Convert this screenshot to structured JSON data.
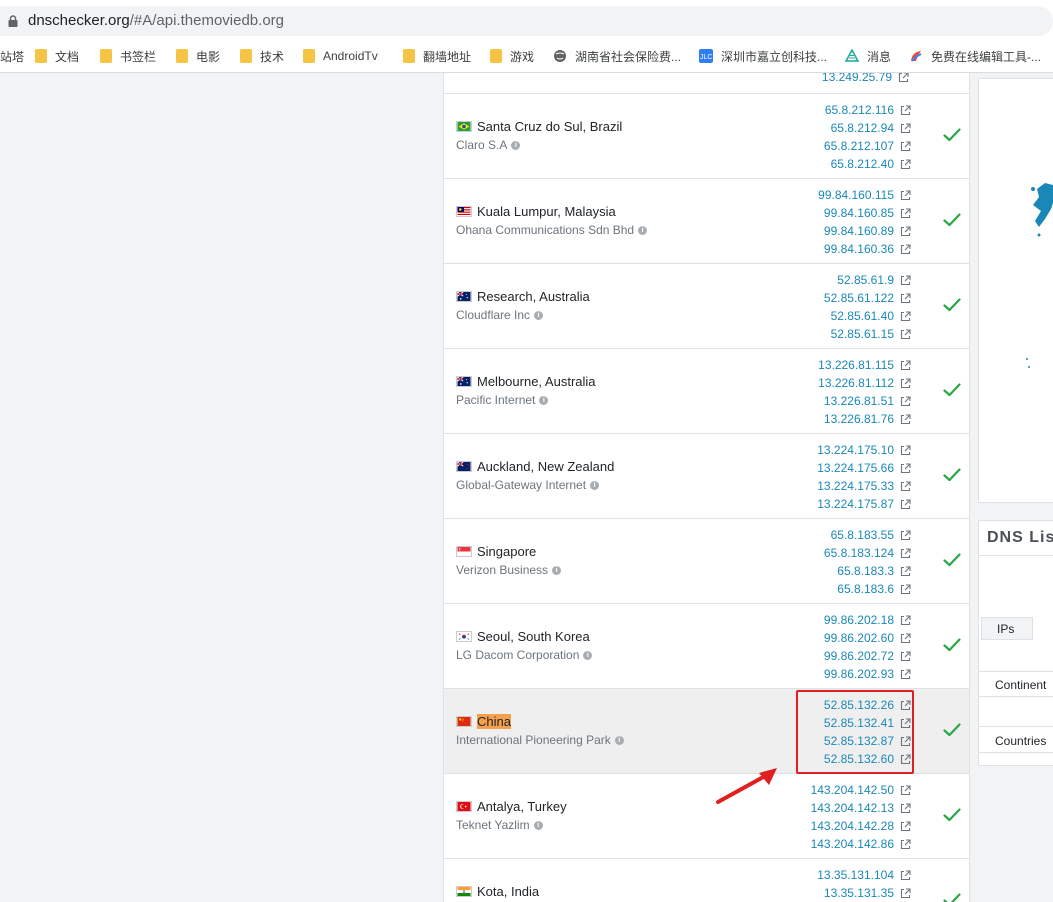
{
  "browser": {
    "url_domain": "dnschecker.org",
    "url_path": "/#A/api.themoviedb.org",
    "bookmarks": [
      {
        "label": "站塔",
        "type": "text"
      },
      {
        "label": "文档",
        "type": "folder"
      },
      {
        "label": "书签栏",
        "type": "folder"
      },
      {
        "label": "电影",
        "type": "folder"
      },
      {
        "label": "技术",
        "type": "folder"
      },
      {
        "label": "AndroidTv",
        "type": "folder"
      },
      {
        "label": "翻墙地址",
        "type": "folder"
      },
      {
        "label": "游戏",
        "type": "folder"
      },
      {
        "label": "湖南省社会保险费...",
        "type": "globe"
      },
      {
        "label": "深圳市嘉立创科技...",
        "type": "jlc"
      },
      {
        "label": "消息",
        "type": "msg"
      },
      {
        "label": "免费在线编辑工具-...",
        "type": "edit"
      }
    ]
  },
  "results": {
    "partial_top_ip": "13.249.25.79",
    "rows": [
      {
        "location": "Santa Cruz do Sul, Brazil",
        "provider": "Claro S.A",
        "flag": "br",
        "ips": [
          "65.8.212.116",
          "65.8.212.94",
          "65.8.212.107",
          "65.8.212.40"
        ]
      },
      {
        "location": "Kuala Lumpur, Malaysia",
        "provider": "Ohana Communications Sdn Bhd",
        "flag": "my",
        "ips": [
          "99.84.160.115",
          "99.84.160.85",
          "99.84.160.89",
          "99.84.160.36"
        ]
      },
      {
        "location": "Research, Australia",
        "provider": "Cloudflare Inc",
        "flag": "au",
        "ips": [
          "52.85.61.9",
          "52.85.61.122",
          "52.85.61.40",
          "52.85.61.15"
        ]
      },
      {
        "location": "Melbourne, Australia",
        "provider": "Pacific Internet",
        "flag": "au",
        "ips": [
          "13.226.81.115",
          "13.226.81.112",
          "13.226.81.51",
          "13.226.81.76"
        ]
      },
      {
        "location": "Auckland, New Zealand",
        "provider": "Global-Gateway Internet",
        "flag": "nz",
        "ips": [
          "13.224.175.10",
          "13.224.175.66",
          "13.224.175.33",
          "13.224.175.87"
        ]
      },
      {
        "location": "Singapore",
        "provider": "Verizon Business",
        "flag": "sg",
        "ips": [
          "65.8.183.55",
          "65.8.183.124",
          "65.8.183.3",
          "65.8.183.6"
        ]
      },
      {
        "location": "Seoul, South Korea",
        "provider": "LG Dacom Corporation",
        "flag": "kr",
        "ips": [
          "99.86.202.18",
          "99.86.202.60",
          "99.86.202.72",
          "99.86.202.93"
        ]
      },
      {
        "location": "China",
        "provider": "International Pioneering Park",
        "flag": "cn",
        "ips": [
          "52.85.132.26",
          "52.85.132.41",
          "52.85.132.87",
          "52.85.132.60"
        ]
      },
      {
        "location": "Antalya, Turkey",
        "provider": "Teknet Yazlim",
        "flag": "tr",
        "ips": [
          "143.204.142.50",
          "143.204.142.13",
          "143.204.142.28",
          "143.204.142.86"
        ]
      },
      {
        "location": "Kota, India",
        "provider": "",
        "flag": "in",
        "ips": [
          "13.35.131.104",
          "13.35.131.35"
        ]
      }
    ]
  },
  "sidebar": {
    "dns_title": "DNS Lis",
    "ips_label": "IPs",
    "continent_label": "Continent",
    "countries_label": "Countries"
  },
  "colors": {
    "link": "#1a88b7",
    "check": "#28a745",
    "highlight": "#f6a04d",
    "annotation": "#e02020"
  }
}
